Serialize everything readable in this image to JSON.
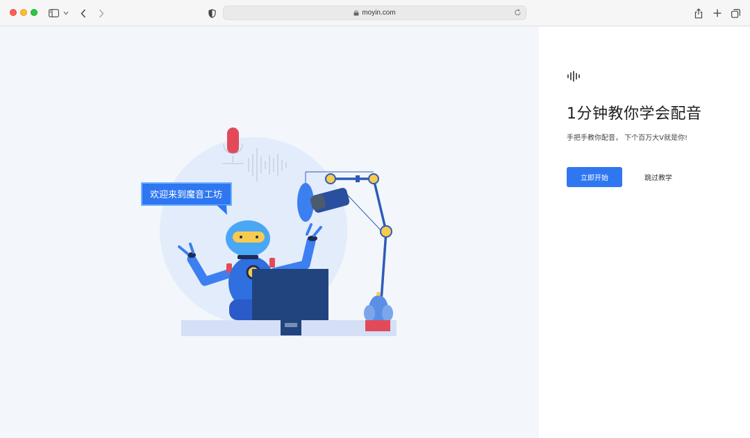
{
  "browser": {
    "url": "moyin.com",
    "icons": [
      "sidebar-icon",
      "chevron-down-icon",
      "back-icon",
      "forward-icon",
      "privacy-shield-icon",
      "lock-icon",
      "reload-icon",
      "share-icon",
      "new-tab-icon",
      "tabs-overview-icon"
    ]
  },
  "hero": {
    "banner_text": "欢迎来到魔音工坊",
    "colors": {
      "accent": "#2f77f0",
      "background": "#f3f6fa",
      "mic_red": "#e24a5a",
      "robot_blue": "#2f6fe0"
    }
  },
  "panel": {
    "logo_icon": "sound-wave-icon",
    "title": "1分钟教你学会配音",
    "subtitle": "手把手教你配音， 下个百万大V就是你!",
    "start_button": "立即开始",
    "skip_button": "跳过教学"
  }
}
